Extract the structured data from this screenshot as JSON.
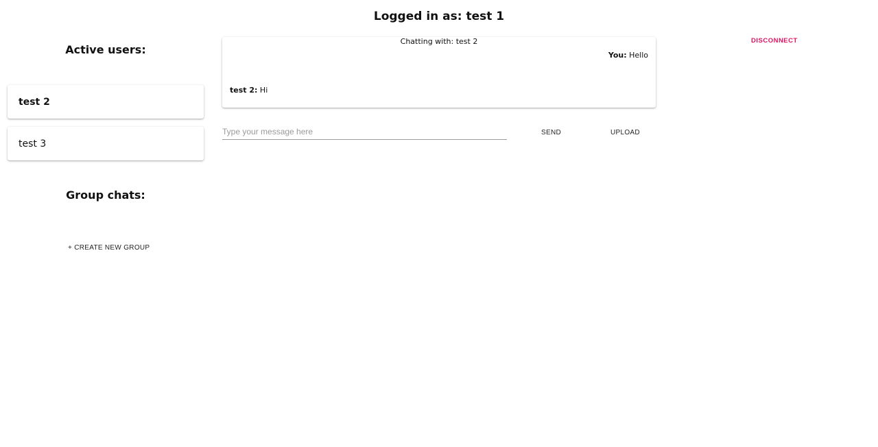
{
  "header": {
    "logged_in_text": "Logged in as: test 1"
  },
  "sidebar": {
    "active_users_title": "Active users:",
    "users": [
      {
        "label": "test 2",
        "selected": true
      },
      {
        "label": "test 3",
        "selected": false
      }
    ],
    "group_chats_title": "Group chats:",
    "create_group_label": "+ CREATE NEW GROUP"
  },
  "chat": {
    "header": "Chatting with: test 2",
    "messages": [
      {
        "sender": "You:",
        "text": "Hello",
        "align": "right"
      },
      {
        "sender": "test 2:",
        "text": "Hi",
        "align": "left"
      }
    ]
  },
  "composer": {
    "placeholder": "Type your message here",
    "value": "",
    "send_label": "SEND",
    "upload_label": "UPLOAD"
  },
  "disconnect": {
    "label": "DISCONNECT",
    "color": "#e0115f"
  }
}
